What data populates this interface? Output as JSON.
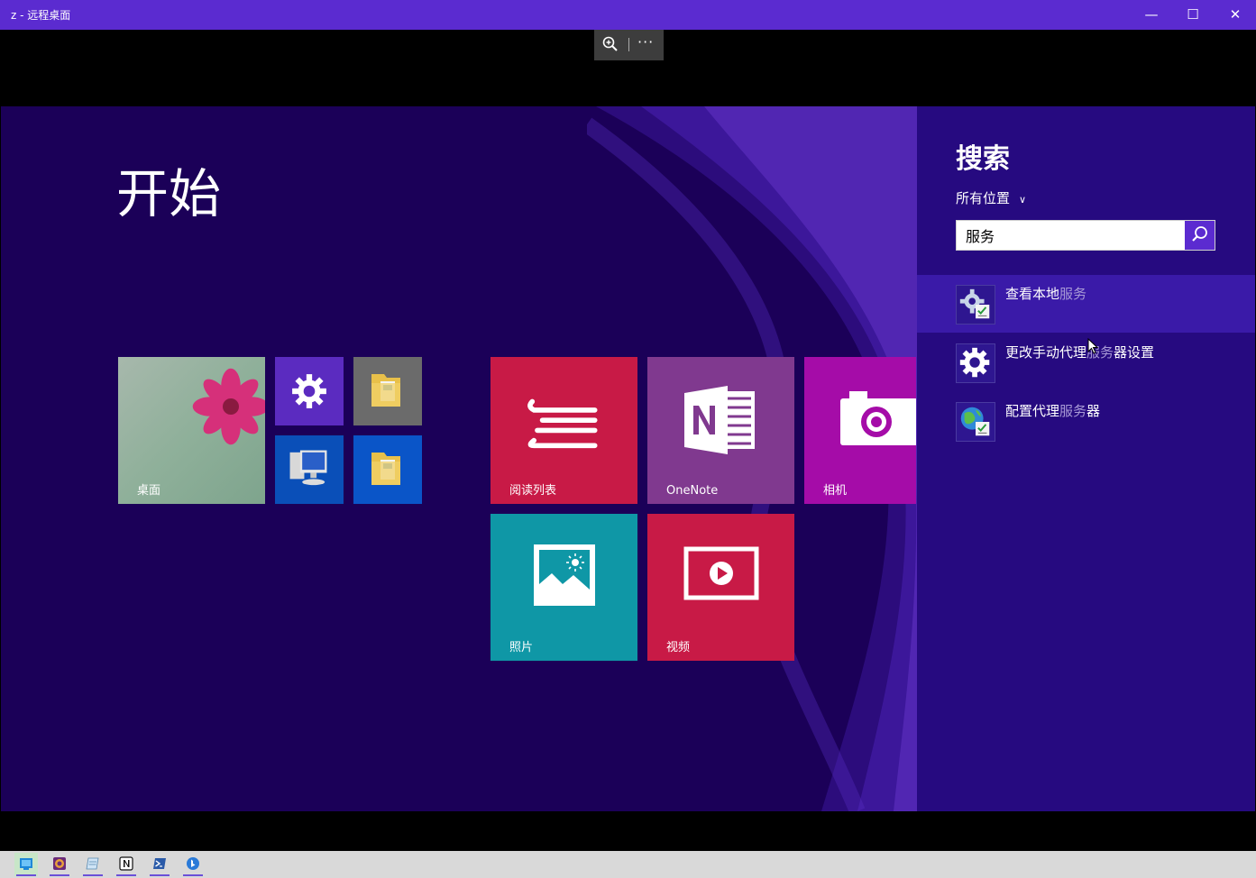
{
  "window": {
    "title": "z - 远程桌面",
    "minimize_glyph": "—",
    "maximize_glyph": "☐",
    "close_glyph": "✕"
  },
  "rd_toolbar": {
    "zoom_icon": "zoom-in-icon",
    "more_label": "···"
  },
  "start": {
    "title": "开始",
    "tiles": [
      {
        "id": "desktop",
        "label": "桌面",
        "color": "#8ca595"
      },
      {
        "id": "pc-settings",
        "label": "",
        "color": "#5b2bc0"
      },
      {
        "id": "file-explorer-1",
        "label": "",
        "color": "#6b6b6b"
      },
      {
        "id": "this-pc",
        "label": "",
        "color": "#0a4fb8"
      },
      {
        "id": "file-explorer-2",
        "label": "",
        "color": "#0a55c8"
      },
      {
        "id": "reading-list",
        "label": "阅读列表",
        "color": "#c81a46"
      },
      {
        "id": "onenote",
        "label": "OneNote",
        "color": "#80398f"
      },
      {
        "id": "camera",
        "label": "相机",
        "color": "#a50ca8"
      },
      {
        "id": "photos",
        "label": "照片",
        "color": "#0f97a6"
      },
      {
        "id": "video",
        "label": "视频",
        "color": "#c81a46"
      }
    ]
  },
  "search": {
    "title": "搜索",
    "scope": "所有位置",
    "query": "服务",
    "results": [
      {
        "prefix": "查看本地",
        "match": "服务",
        "suffix": ""
      },
      {
        "prefix": "更改手动代理",
        "match": "服务",
        "suffix": "器设置"
      },
      {
        "prefix": "配置代理",
        "match": "服务",
        "suffix": "器"
      }
    ]
  },
  "taskbar": {
    "items": [
      "remote-desktop-icon",
      "browser-icon",
      "notepad-icon",
      "notion-icon",
      "powershell-icon",
      "bing-icon"
    ]
  }
}
